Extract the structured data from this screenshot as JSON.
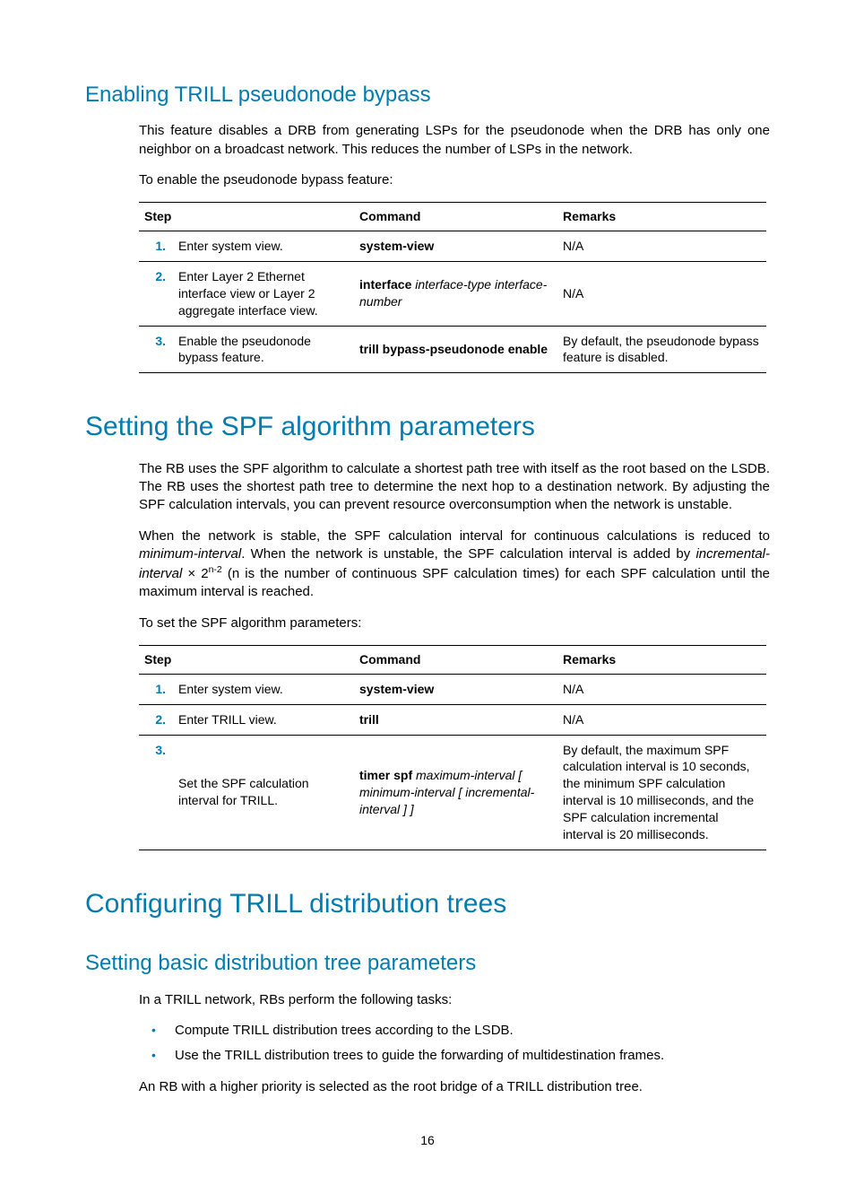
{
  "section1": {
    "heading": "Enabling TRILL pseudonode bypass",
    "p1": "This feature disables a DRB from generating LSPs for the pseudonode when the DRB has only one neighbor on a broadcast network. This reduces the number of LSPs in the network.",
    "p2": "To enable the pseudonode bypass feature:",
    "table": {
      "headers": {
        "step": "Step",
        "command": "Command",
        "remarks": "Remarks"
      },
      "rows": [
        {
          "num": "1.",
          "step": "Enter system view.",
          "cmd_b": "system-view",
          "cmd_i": "",
          "remarks": "N/A"
        },
        {
          "num": "2.",
          "step": "Enter Layer 2 Ethernet interface view or Layer 2 aggregate interface view.",
          "cmd_b": "interface",
          "cmd_i": " interface-type interface-number",
          "remarks": "N/A"
        },
        {
          "num": "3.",
          "step": "Enable the pseudonode bypass feature.",
          "cmd_b": "trill bypass-pseudonode enable",
          "cmd_i": "",
          "remarks": "By default, the pseudonode bypass feature is disabled."
        }
      ]
    }
  },
  "section2": {
    "heading": "Setting the SPF algorithm parameters",
    "p1": "The RB uses the SPF algorithm to calculate a shortest path tree with itself as the root based on the LSDB. The RB uses the shortest path tree to determine the next hop to a destination network. By adjusting the SPF calculation intervals, you can prevent resource overconsumption when the network is unstable.",
    "p2a": "When the network is stable, the SPF calculation interval for continuous calculations is reduced to ",
    "p2b_i": "minimum-interval",
    "p2c": ". When the network is unstable, the SPF calculation interval is added by ",
    "p2d_i": "incremental-interval",
    "p2e": " × 2",
    "p2f_sup": "n-2",
    "p2g": " (n is the number of continuous SPF calculation times) for each SPF calculation until the maximum interval is reached.",
    "p3": "To set the SPF algorithm parameters:",
    "table": {
      "headers": {
        "step": "Step",
        "command": "Command",
        "remarks": "Remarks"
      },
      "rows": [
        {
          "num": "1.",
          "step": "Enter system view.",
          "cmd_b": "system-view",
          "cmd_i": "",
          "remarks": "N/A"
        },
        {
          "num": "2.",
          "step": "Enter TRILL view.",
          "cmd_b": "trill",
          "cmd_i": "",
          "remarks": "N/A"
        },
        {
          "num": "3.",
          "step": "Set the SPF calculation interval for TRILL.",
          "cmd_b": "timer spf",
          "cmd_i": " maximum-interval [ minimum-interval [ incremental-interval ] ]",
          "remarks": "By default, the maximum SPF calculation interval is 10 seconds, the minimum SPF calculation interval is 10 milliseconds, and the SPF calculation incremental interval is 20 milliseconds."
        }
      ]
    }
  },
  "section3": {
    "heading": "Configuring TRILL distribution trees",
    "subheading": "Setting basic distribution tree parameters",
    "p1": "In a TRILL network, RBs perform the following tasks:",
    "tasks": [
      "Compute TRILL distribution trees according to the LSDB.",
      "Use the TRILL distribution trees to guide the forwarding of multidestination frames."
    ],
    "p2": "An RB with a higher priority is selected as the root bridge of a TRILL distribution tree."
  },
  "page_number": "16"
}
